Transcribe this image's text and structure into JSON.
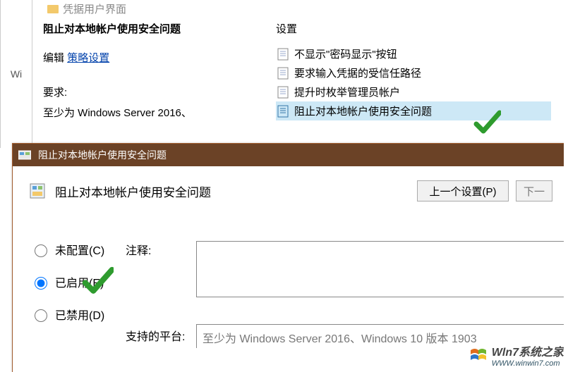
{
  "back": {
    "tree_label": "Wi",
    "top_item": "凭据用户界面",
    "policy_title": "阻止对本地帐户使用安全问题",
    "edit_prefix": "编辑",
    "edit_link": "策略设置",
    "req_label": "要求:",
    "req_text": "至少为 Windows Server 2016、",
    "settings_label": "设置",
    "items": [
      {
        "label": "不显示\"密码显示\"按钮"
      },
      {
        "label": "要求输入凭据的受信任路径"
      },
      {
        "label": "提升时枚举管理员帐户"
      },
      {
        "label": "阻止对本地帐户使用安全问题"
      }
    ]
  },
  "dialog": {
    "title": "阻止对本地帐户使用安全问题",
    "policy_title": "阻止对本地帐户使用安全问题",
    "prev_btn": "上一个设置(P)",
    "next_btn": "下一",
    "radios": {
      "not_configured": "未配置(C)",
      "enabled": "已启用(E)",
      "disabled": "已禁用(D)"
    },
    "comment_label": "注释:",
    "comment_value": "",
    "platform_label": "支持的平台:",
    "platform_value": "至少为 Windows Server 2016、Windows 10 版本 1903"
  },
  "watermark": {
    "main": "Wln7系统之家",
    "sub": "WWW.winwin7.com"
  }
}
